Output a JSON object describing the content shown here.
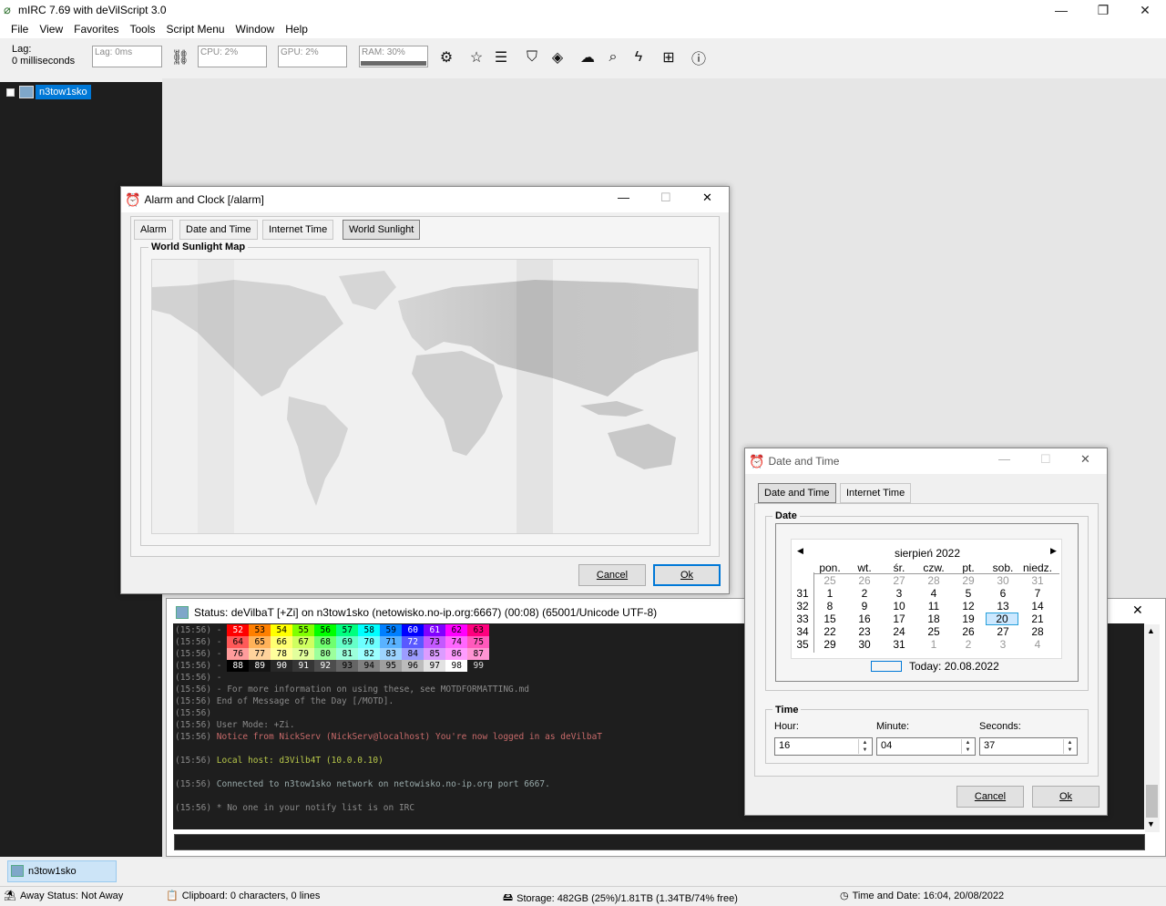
{
  "app": {
    "title": "mIRC 7.69 with deVilScript 3.0"
  },
  "menu": [
    "File",
    "View",
    "Favorites",
    "Tools",
    "Script Menu",
    "Window",
    "Help"
  ],
  "toolbar": {
    "lag_label": "Lag:",
    "lag_value": "0 milliseconds",
    "lag_meter": "Lag: 0ms",
    "cpu": "CPU: 2%",
    "gpu": "GPU: 2%",
    "ram": "RAM: 30%",
    "ram_fraction": 0.3
  },
  "tree": {
    "server": "n3tow1sko"
  },
  "alarm_dialog": {
    "title": "Alarm and Clock [/alarm]",
    "tabs": [
      "Alarm",
      "Date and Time",
      "Internet Time",
      "World Sunlight"
    ],
    "active_tab": "World Sunlight",
    "group_label": "World Sunlight Map",
    "cancel": "Cancel",
    "ok": "Ok"
  },
  "status": {
    "title": "Status: deVilbaT [+Zi] on n3tow1sko (netowisko.no-ip.org:6667) (00:08) (65001/Unicode UTF-8)",
    "color_rows": [
      {
        "time": "(15:56)",
        "codes": [
          "52",
          "53",
          "54",
          "55",
          "56",
          "57",
          "58",
          "59",
          "60",
          "61",
          "62",
          "63"
        ],
        "colors": [
          "#ff0000",
          "#ff7f00",
          "#ffff00",
          "#80ff00",
          "#00ff00",
          "#00ff7f",
          "#00ffff",
          "#007fff",
          "#0000ff",
          "#7f00ff",
          "#ff00ff",
          "#ff007f"
        ]
      },
      {
        "time": "(15:56)",
        "codes": [
          "64",
          "65",
          "66",
          "67",
          "68",
          "69",
          "70",
          "71",
          "72",
          "73",
          "74",
          "75"
        ],
        "colors": [
          "#ff5959",
          "#ffb259",
          "#ffff71",
          "#cfff60",
          "#6fff6f",
          "#65ffc9",
          "#6dffff",
          "#59b2ff",
          "#5959ff",
          "#c459ff",
          "#ff66ff",
          "#ff59bc"
        ]
      },
      {
        "time": "(15:56)",
        "codes": [
          "76",
          "77",
          "78",
          "79",
          "80",
          "81",
          "82",
          "83",
          "84",
          "85",
          "86",
          "87"
        ],
        "colors": [
          "#ff9c9c",
          "#ffd39c",
          "#ffff9c",
          "#e2ff9c",
          "#9cff9c",
          "#9cffdb",
          "#9cffff",
          "#9cd3ff",
          "#9c9cff",
          "#dc9cff",
          "#ff9cff",
          "#ff94d3"
        ]
      },
      {
        "time": "(15:56)",
        "codes": [
          "88",
          "89",
          "90",
          "91",
          "92",
          "93",
          "94",
          "95",
          "96",
          "97",
          "98",
          "99"
        ],
        "colors": [
          "#000000",
          "#131313",
          "#282828",
          "#363636",
          "#4d4d4d",
          "#656565",
          "#818181",
          "#9f9f9f",
          "#bcbcbc",
          "#e2e2e2",
          "#ffffff",
          "#1e1e1e"
        ]
      }
    ],
    "lines": [
      {
        "time": "(15:56)",
        "text": " -"
      },
      {
        "time": "(15:56)",
        "text": " - For more information on using these, see MOTDFORMATTING.md"
      },
      {
        "time": "(15:56)",
        "text": " End of Message of the Day [/MOTD]."
      },
      {
        "time": "(15:56)",
        "text": ""
      },
      {
        "time": "(15:56)",
        "text": " User Mode: +Zi."
      },
      {
        "time": "(15:56)",
        "text": " Notice from NickServ (NickServ@localhost) You're now logged in as deVilbaT"
      },
      {
        "time": "",
        "text": ""
      },
      {
        "time": "(15:56)",
        "text": " Local host: d3Vilb4T (10.0.0.10)"
      },
      {
        "time": "",
        "text": ""
      },
      {
        "time": "(15:56)",
        "text": " Connected to n3tow1sko network on netowisko.no-ip.org port 6667."
      },
      {
        "time": "",
        "text": ""
      },
      {
        "time": "(15:56)",
        "text": " * No one in your notify list is on IRC"
      }
    ]
  },
  "date_dialog": {
    "title": "Date and Time",
    "tabs": [
      "Date and Time",
      "Internet Time"
    ],
    "date_group": "Date",
    "month": "sierpień 2022",
    "weekdays": [
      "pon.",
      "wt.",
      "śr.",
      "czw.",
      "pt.",
      "sob.",
      "niedz."
    ],
    "weeks": [
      {
        "num": "",
        "days": [
          "25",
          "26",
          "27",
          "28",
          "29",
          "30",
          "31"
        ],
        "muted": [
          1,
          1,
          1,
          1,
          1,
          1,
          1
        ]
      },
      {
        "num": "31",
        "days": [
          "1",
          "2",
          "3",
          "4",
          "5",
          "6",
          "7"
        ],
        "muted": [
          0,
          0,
          0,
          0,
          0,
          0,
          0
        ]
      },
      {
        "num": "32",
        "days": [
          "8",
          "9",
          "10",
          "11",
          "12",
          "13",
          "14"
        ],
        "muted": [
          0,
          0,
          0,
          0,
          0,
          0,
          0
        ]
      },
      {
        "num": "33",
        "days": [
          "15",
          "16",
          "17",
          "18",
          "19",
          "20",
          "21"
        ],
        "muted": [
          0,
          0,
          0,
          0,
          0,
          0,
          0
        ]
      },
      {
        "num": "34",
        "days": [
          "22",
          "23",
          "24",
          "25",
          "26",
          "27",
          "28"
        ],
        "muted": [
          0,
          0,
          0,
          0,
          0,
          0,
          0
        ]
      },
      {
        "num": "35",
        "days": [
          "29",
          "30",
          "31",
          "1",
          "2",
          "3",
          "4"
        ],
        "muted": [
          0,
          0,
          0,
          1,
          1,
          1,
          1
        ]
      }
    ],
    "selected_day": "20",
    "today": "Today: 20.08.2022",
    "time_group": "Time",
    "hour_label": "Hour:",
    "minute_label": "Minute:",
    "seconds_label": "Seconds:",
    "hour": "16",
    "minute": "04",
    "seconds": "37",
    "cancel": "Cancel",
    "ok": "Ok"
  },
  "switchbar": {
    "item": "n3tow1sko"
  },
  "statusbar": {
    "away": "Away Status: Not Away",
    "clipboard": "Clipboard: 0 characters, 0 lines",
    "storage": "Storage: 482GB (25%)/1.81TB (1.34TB/74% free)",
    "time": "Time and Date: 16:04, 20/08/2022"
  }
}
